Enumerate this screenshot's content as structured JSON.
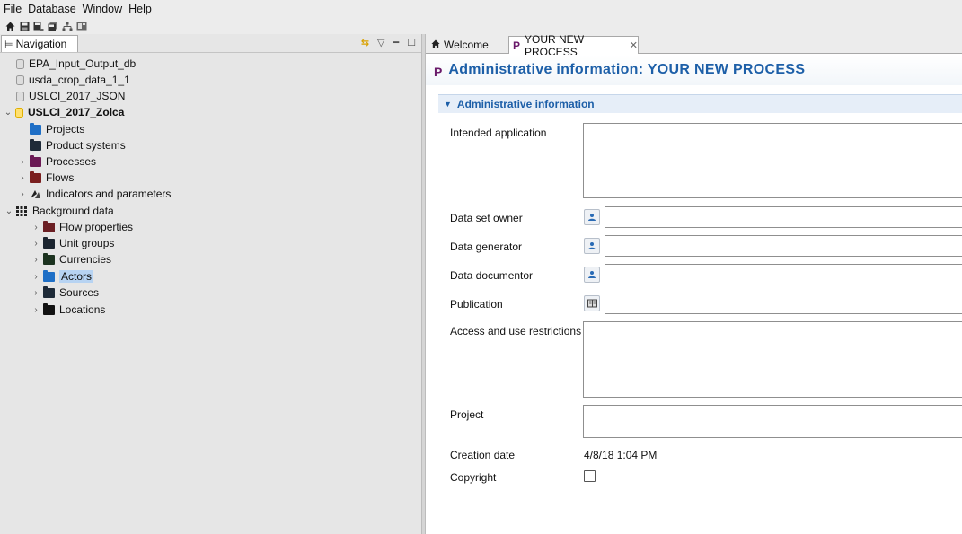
{
  "menu": [
    "File",
    "Database",
    "Window",
    "Help"
  ],
  "toolbar": {
    "icons": [
      "home-icon",
      "save-icon",
      "save-as-icon",
      "save-all-icon",
      "sitemap-icon",
      "report-icon"
    ]
  },
  "navigation": {
    "tab_label": "Navigation",
    "tree": [
      {
        "label": "EPA_Input_Output_db",
        "icon": "database-icon"
      },
      {
        "label": "usda_crop_data_1_1",
        "icon": "database-icon"
      },
      {
        "label": "USLCI_2017_JSON",
        "icon": "database-icon"
      },
      {
        "label": "USLCI_2017_Zolca",
        "icon": "database-icon-active"
      },
      {
        "label": "Projects",
        "icon": "folder-icon"
      },
      {
        "label": "Product systems",
        "icon": "folder-icon"
      },
      {
        "label": "Processes",
        "icon": "folder-icon"
      },
      {
        "label": "Flows",
        "icon": "folder-icon"
      },
      {
        "label": "Indicators and parameters",
        "icon": "indicators-icon"
      },
      {
        "label": "Background data",
        "icon": "grid-icon"
      },
      {
        "label": "Flow properties",
        "icon": "folder-icon"
      },
      {
        "label": "Unit groups",
        "icon": "folder-icon"
      },
      {
        "label": "Currencies",
        "icon": "folder-icon"
      },
      {
        "label": "Actors",
        "icon": "folder-icon"
      },
      {
        "label": "Sources",
        "icon": "folder-icon"
      },
      {
        "label": "Locations",
        "icon": "folder-icon"
      }
    ]
  },
  "editor": {
    "tabs": [
      {
        "label": "Welcome"
      },
      {
        "label": "YOUR NEW PROCESS",
        "icon_letter": "P"
      }
    ],
    "title_icon_letter": "P",
    "title": "Administrative information: YOUR NEW PROCESS",
    "section_title": "Administrative information",
    "fields": {
      "intended_application": "Intended application",
      "data_set_owner": "Data set owner",
      "data_generator": "Data generator",
      "data_documentor": "Data documentor",
      "publication": "Publication",
      "access_restrictions": "Access and use restrictions",
      "project": "Project",
      "creation_date": "Creation date",
      "copyright": "Copyright"
    },
    "values": {
      "creation_date": "4/8/18 1:04 PM",
      "copyright_checked": false
    }
  },
  "colors": {
    "title_blue": "#1d5fa8",
    "process_purple": "#6a1a6a",
    "selection": "#b7d3f2"
  }
}
